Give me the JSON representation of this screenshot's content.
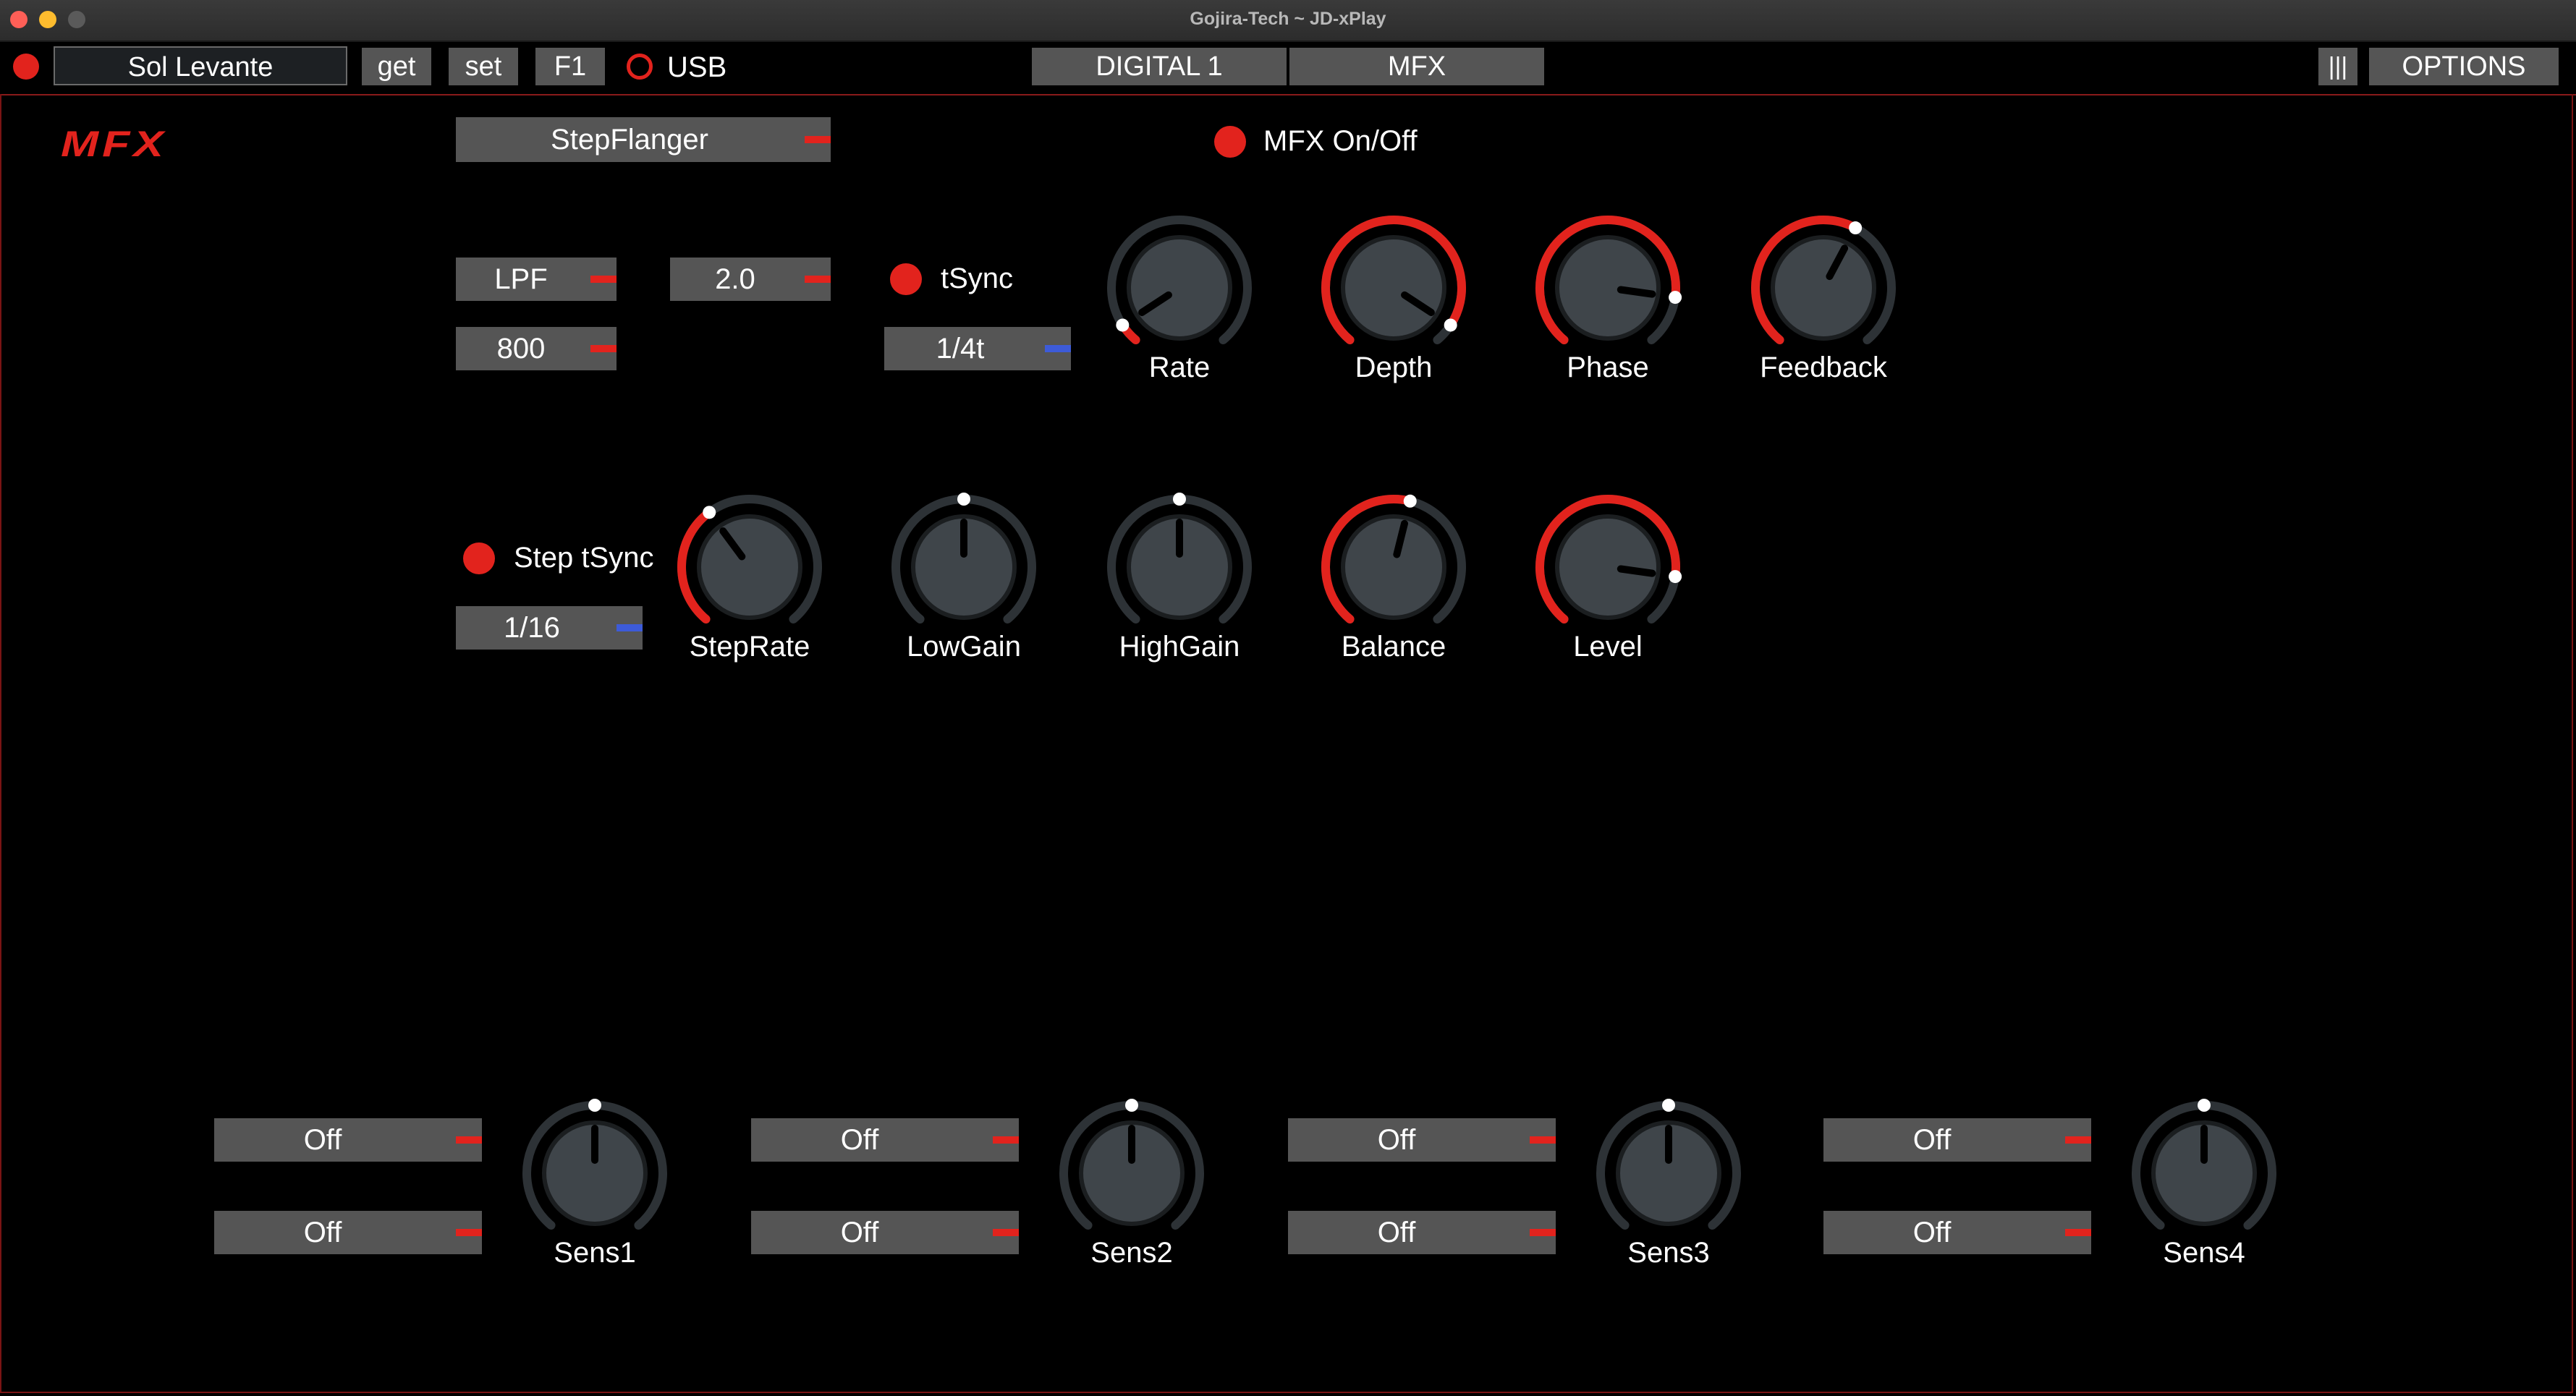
{
  "window": {
    "title": "Gojira-Tech ~ JD-xPlay"
  },
  "toolbar": {
    "patch_name": "Sol Levante",
    "get_label": "get",
    "set_label": "set",
    "f1_label": "F1",
    "usb_label": "USB",
    "tab_digital": "DIGITAL 1",
    "tab_mfx": "MFX",
    "menu_label": "|||",
    "options_label": "OPTIONS"
  },
  "mfx": {
    "section_logo": "MFX",
    "type": "StepFlanger",
    "onoff_label": "MFX On/Off",
    "filter_type": "LPF",
    "cutoff": "800",
    "ratio": "2.0",
    "tsync_label": "tSync",
    "tsync_value": "1/4t",
    "step_tsync_label": "Step tSync",
    "step_tsync_value": "1/16",
    "knobs_row1": [
      {
        "label": "Rate",
        "value": 0.06
      },
      {
        "label": "Depth",
        "value": 0.94
      },
      {
        "label": "Phase",
        "value": 0.85
      },
      {
        "label": "Feedback",
        "value": 0.6
      }
    ],
    "knobs_row2": [
      {
        "label": "StepRate",
        "value": 0.37
      },
      {
        "label": "LowGain",
        "value": 0.5
      },
      {
        "label": "HighGain",
        "value": 0.5
      },
      {
        "label": "Balance",
        "value": 0.55
      },
      {
        "label": "Level",
        "value": 0.85
      }
    ],
    "sens": [
      {
        "label": "Sens1",
        "dd1": "Off",
        "dd2": "Off",
        "value": 0.5
      },
      {
        "label": "Sens2",
        "dd1": "Off",
        "dd2": "Off",
        "value": 0.5
      },
      {
        "label": "Sens3",
        "dd1": "Off",
        "dd2": "Off",
        "value": 0.5
      },
      {
        "label": "Sens4",
        "dd1": "Off",
        "dd2": "Off",
        "value": 0.5
      }
    ]
  },
  "colors": {
    "accent": "#e2231d",
    "control": "#555555",
    "track": "#2d3236",
    "knob": "#3f454a",
    "sync_mark": "#3d5bd8"
  }
}
